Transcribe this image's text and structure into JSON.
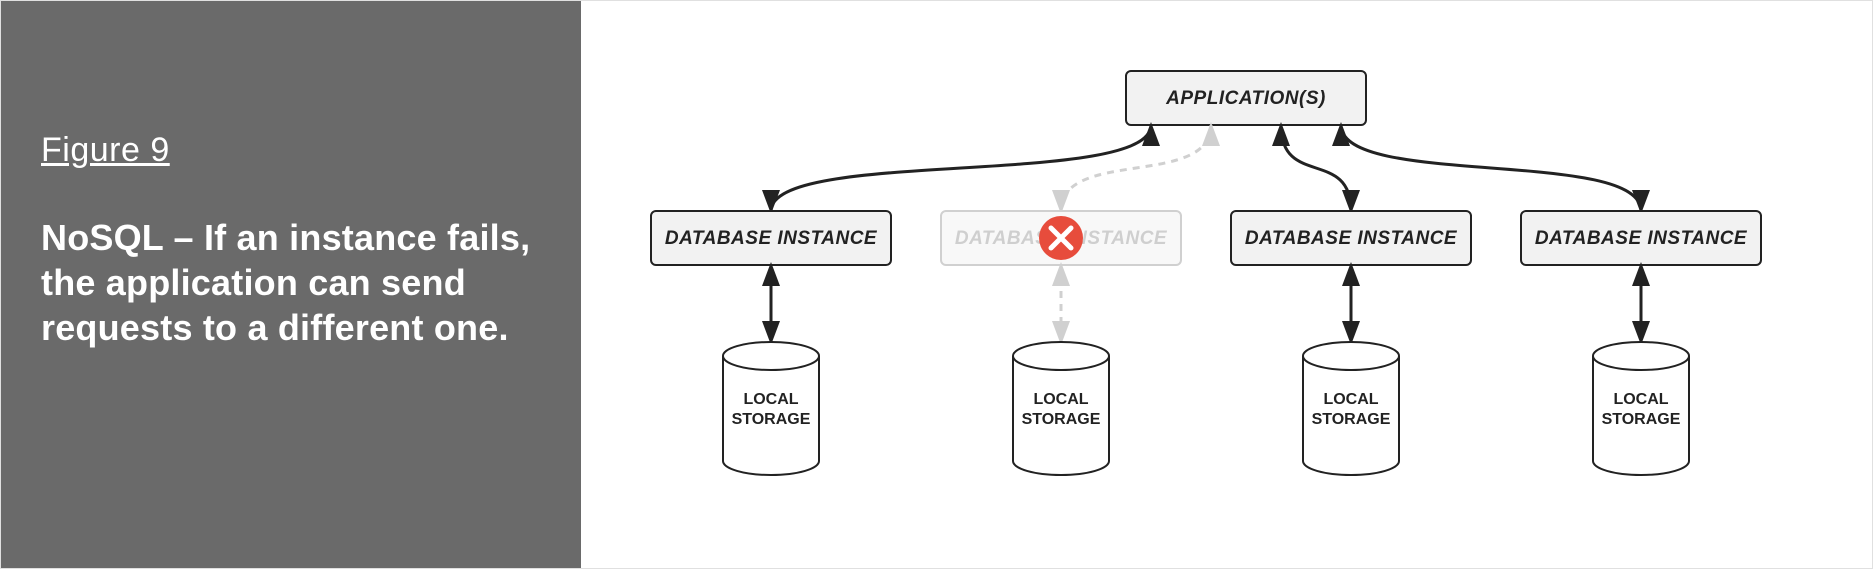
{
  "figure_label": "Figure 9",
  "caption": "NoSQL – If an instance fails, the application can send requests to a different one.",
  "diagram": {
    "app_label": "APPLICATION(S)",
    "instances": [
      {
        "label": "DATABASE INSTANCE",
        "failed": false
      },
      {
        "label": "DATABASE INSTANCE",
        "failed": true
      },
      {
        "label": "DATABASE INSTANCE",
        "failed": false
      },
      {
        "label": "DATABASE INSTANCE",
        "failed": false
      }
    ],
    "storage_label_line1": "LOCAL",
    "storage_label_line2": "STORAGE",
    "error_icon_color": "#e74c3c",
    "box_fill": "#f2f2f2",
    "failed_fill": "#f8f8f8",
    "failed_text": "#cfcfcf",
    "stroke": "#222222",
    "failed_stroke": "#d0d0d0"
  }
}
